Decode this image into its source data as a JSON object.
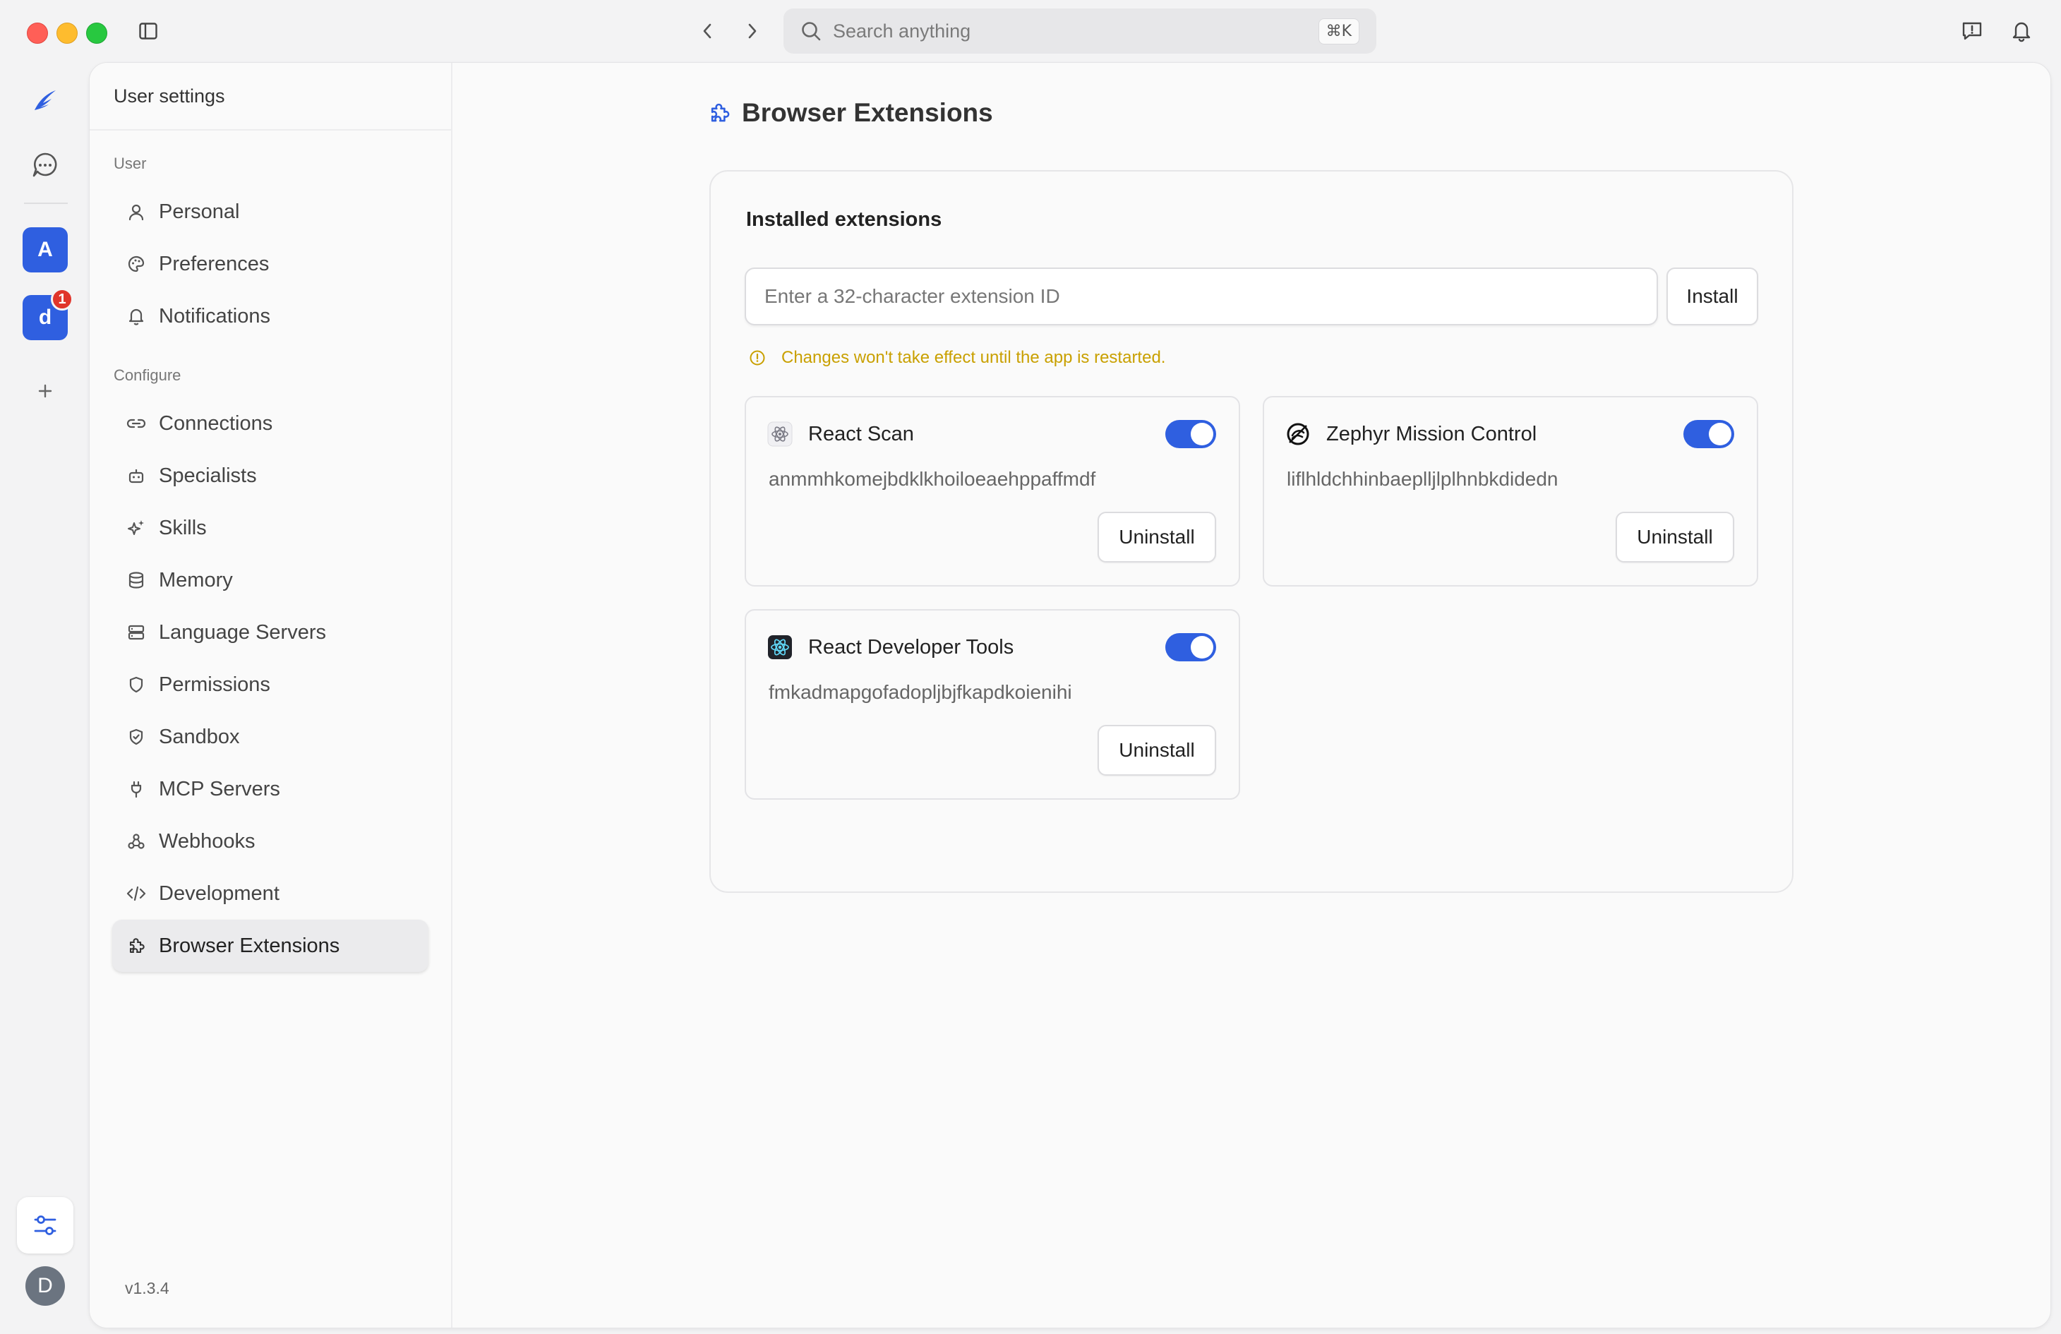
{
  "titlebar": {
    "search_placeholder": "Search anything",
    "search_shortcut": "⌘K"
  },
  "rail": {
    "workspaces": [
      {
        "initial": "A",
        "color": "#2f5fe0"
      },
      {
        "initial": "d",
        "color": "#2f5fe0",
        "badge": "1"
      }
    ],
    "user_initial": "D"
  },
  "sidebar": {
    "header": "User settings",
    "section_user": "User",
    "section_configure": "Configure",
    "user_items": [
      {
        "label": "Personal",
        "icon": "user-icon"
      },
      {
        "label": "Preferences",
        "icon": "palette-icon"
      },
      {
        "label": "Notifications",
        "icon": "bell-icon"
      }
    ],
    "configure_items": [
      {
        "label": "Connections",
        "icon": "link-icon"
      },
      {
        "label": "Specialists",
        "icon": "bot-icon"
      },
      {
        "label": "Skills",
        "icon": "sparkles-icon"
      },
      {
        "label": "Memory",
        "icon": "database-icon"
      },
      {
        "label": "Language Servers",
        "icon": "server-icon"
      },
      {
        "label": "Permissions",
        "icon": "shield-icon"
      },
      {
        "label": "Sandbox",
        "icon": "shield-check-icon"
      },
      {
        "label": "MCP Servers",
        "icon": "plug-icon"
      },
      {
        "label": "Webhooks",
        "icon": "webhook-icon"
      },
      {
        "label": "Development",
        "icon": "code-icon"
      },
      {
        "label": "Browser Extensions",
        "icon": "puzzle-icon",
        "active": true
      }
    ],
    "version": "v1.3.4"
  },
  "content": {
    "page_title": "Browser Extensions",
    "panel_title": "Installed extensions",
    "input_placeholder": "Enter a 32-character extension ID",
    "install_label": "Install",
    "warning": "Changes won't take effect until the app is restarted.",
    "uninstall_label": "Uninstall",
    "extensions": [
      {
        "name": "React Scan",
        "id": "anmmhkomejbdklkhoiloeaehppaffmdf",
        "enabled": true,
        "icon": "react-scan-icon"
      },
      {
        "name": "Zephyr Mission Control",
        "id": "liflhldchhinbaeplljlplhnbkdidedn",
        "enabled": true,
        "icon": "zephyr-icon"
      },
      {
        "name": "React Developer Tools",
        "id": "fmkadmapgofadopljbjfkapdkoienihi",
        "enabled": true,
        "icon": "react-devtools-icon"
      }
    ]
  },
  "colors": {
    "accent": "#2f5fe0",
    "warning": "#c9a000",
    "badge": "#e0352b"
  }
}
